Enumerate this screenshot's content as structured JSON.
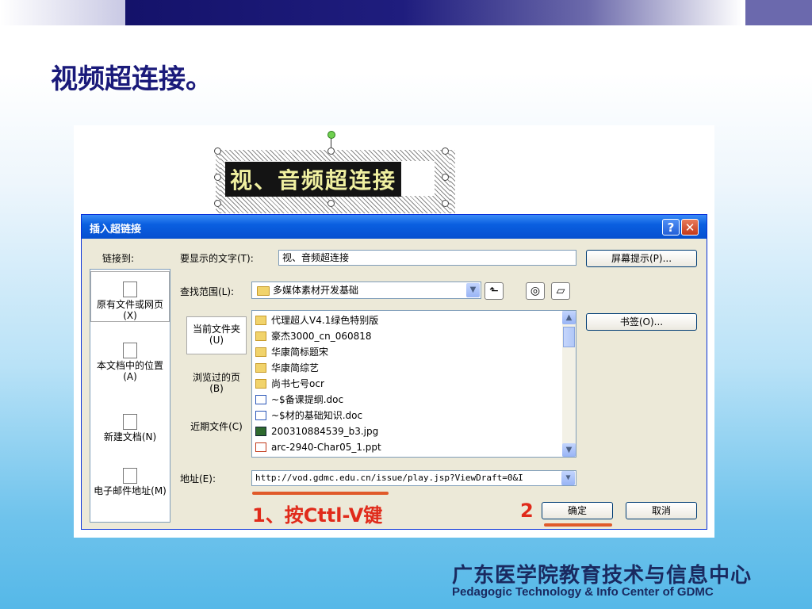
{
  "slide": {
    "title": "视频超连接。",
    "footer_cn": "广东医学院教育技术与信息中心",
    "footer_en": "Pedagogic Technology & Info Center of GDMC"
  },
  "textbox": {
    "text": "视、音频超连接"
  },
  "dialog": {
    "title": "插入超链接",
    "help_label": "?",
    "close_label": "✕",
    "link_to_label": "链接到:",
    "link_items": [
      {
        "label": "原有文件或网页(X)",
        "icon": "web-page-icon"
      },
      {
        "label": "本文档中的位置(A)",
        "icon": "document-place-icon"
      },
      {
        "label": "新建文档(N)",
        "icon": "new-document-icon"
      },
      {
        "label": "电子邮件地址(M)",
        "icon": "email-icon"
      }
    ],
    "display_text_label": "要显示的文字(T):",
    "display_text_value": "视、音频超连接",
    "screentip_button": "屏幕提示(P)...",
    "lookin_label": "查找范围(L):",
    "lookin_value": "多媒体素材开发基础",
    "bookmark_button": "书签(O)...",
    "scope_items": [
      "当前文件夹(U)",
      "浏览过的页(B)",
      "近期文件(C)"
    ],
    "files": [
      {
        "name": "代理超人V4.1绿色特别版",
        "type": "folder"
      },
      {
        "name": "豪杰3000_cn_060818",
        "type": "folder"
      },
      {
        "name": "华康简标题宋",
        "type": "folder"
      },
      {
        "name": "华康简综艺",
        "type": "folder"
      },
      {
        "name": "尚书七号ocr",
        "type": "folder"
      },
      {
        "name": "~$备课提纲.doc",
        "type": "doc"
      },
      {
        "name": "~$材的基础知识.doc",
        "type": "doc"
      },
      {
        "name": "200310884539_b3.jpg",
        "type": "jpg"
      },
      {
        "name": "arc-2940-Char05_1.ppt",
        "type": "ppt"
      }
    ],
    "address_label": "地址(E):",
    "address_value": "http://vod.gdmc.edu.cn/issue/play.jsp?ViewDraft=0&I",
    "ok_button": "确定",
    "cancel_button": "取消"
  },
  "annotations": {
    "step1": "1、按Cttl-V键",
    "step2": "2"
  },
  "colors": {
    "title_blue": "#1a1a7a",
    "annotation_red": "#e02a1a",
    "xp_titlebar": "#0a5fe0"
  }
}
